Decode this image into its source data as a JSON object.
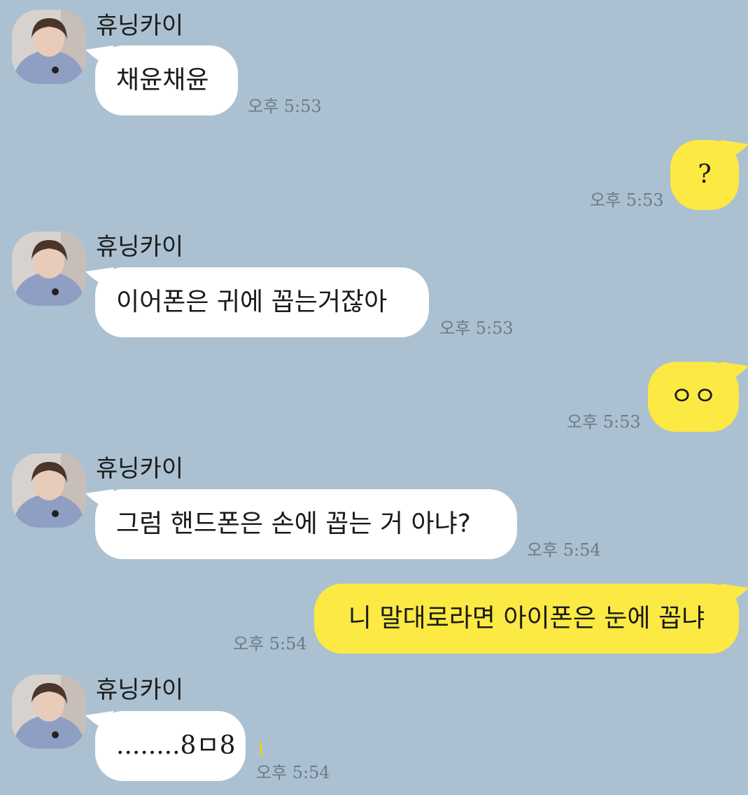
{
  "chat": {
    "messages": [
      {
        "direction": "in",
        "sender": "휴닝카이",
        "text": "채윤채윤",
        "time": "오후 5:53"
      },
      {
        "direction": "out",
        "text": "?",
        "time": "오후 5:53"
      },
      {
        "direction": "in",
        "sender": "휴닝카이",
        "text": "이어폰은 귀에 꼽는거잖아",
        "time": "오후 5:53"
      },
      {
        "direction": "out",
        "text": "ㅇㅇ",
        "time": "오후 5:53"
      },
      {
        "direction": "in",
        "sender": "휴닝카이",
        "text": "그럼 핸드폰은 손에 꼽는 거 아냐?",
        "time": "오후 5:54"
      },
      {
        "direction": "out",
        "text": "니 말대로라면 아이폰은 눈에 꼽냐",
        "time": "오후 5:54"
      },
      {
        "direction": "in",
        "sender": "휴닝카이",
        "text": "........8ㅁ8",
        "time": "오후 5:54",
        "unread": "1"
      }
    ]
  },
  "colors": {
    "background": "#abc1d1",
    "incoming_bubble": "#ffffff",
    "outgoing_bubble": "#fce943",
    "timestamp": "#6b7a88",
    "unread_count": "#f2d500"
  },
  "icons": {
    "avatar": "profile-photo"
  }
}
